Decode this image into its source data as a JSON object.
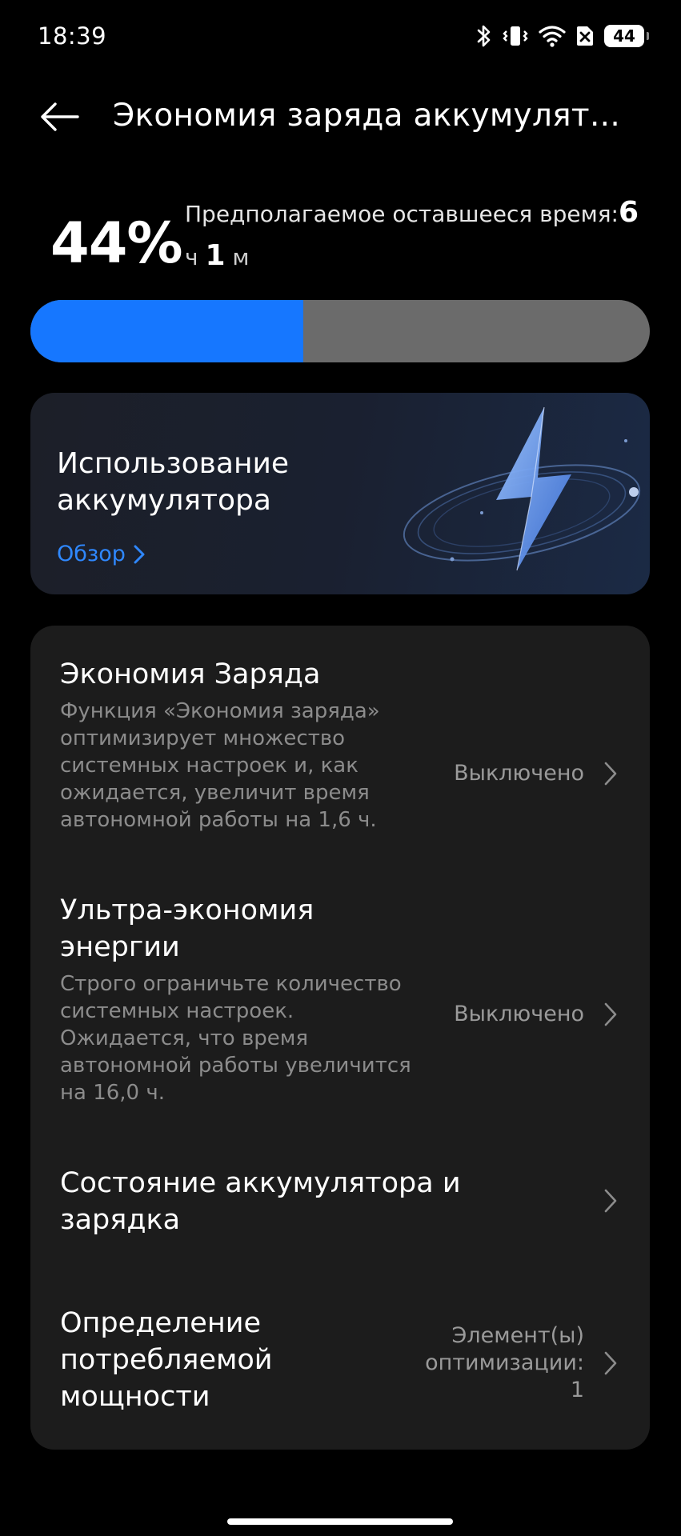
{
  "status_bar": {
    "time": "18:39",
    "battery_level": "44",
    "icons": [
      "bluetooth-icon",
      "vibrate-icon",
      "wifi-icon",
      "no-sim-icon",
      "battery-icon"
    ]
  },
  "header": {
    "title": "Экономия заряда аккумулят..."
  },
  "battery": {
    "percent_label": "44%",
    "percent_value": 44,
    "remaining_label": "Предполагаемое оставшееся время:",
    "hours": "6",
    "hours_unit": "ч",
    "minutes": "1",
    "minutes_unit": "м"
  },
  "usage_card": {
    "title": "Использование аккумулятора",
    "link": "Обзор"
  },
  "settings": [
    {
      "title": "Экономия Заряда",
      "description": "Функция «Экономия заряда» оптимизирует множество системных настроек и, как ожидается, увеличит время автономной работы на 1,6 ч.",
      "value": "Выключено"
    },
    {
      "title": "Ультра-экономия энергии",
      "description": "Строго ограничьте количество системных настроек. Ожидается, что время автономной работы увеличится на 16,0 ч.",
      "value": "Выключено"
    },
    {
      "title": "Состояние аккумулятора и зарядка",
      "description": "",
      "value": ""
    },
    {
      "title": "Определение потребляемой мощности",
      "description": "",
      "value": "Элемент(ы) оптимизации: 1"
    }
  ],
  "colors": {
    "accent": "#1677ff",
    "link": "#2f88ff",
    "card": "#1c1c1c"
  }
}
